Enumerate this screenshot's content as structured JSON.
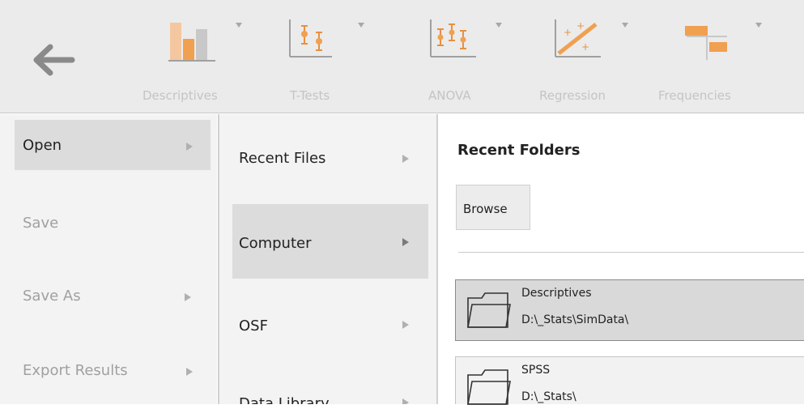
{
  "toolbar": {
    "tools": [
      {
        "label": "Descriptives",
        "icon": "descriptives-bar-icon"
      },
      {
        "label": "T-Tests",
        "icon": "t-tests-icon"
      },
      {
        "label": "ANOVA",
        "icon": "anova-icon"
      },
      {
        "label": "Regression",
        "icon": "regression-icon"
      },
      {
        "label": "Frequencies",
        "icon": "frequencies-icon"
      }
    ]
  },
  "menu": {
    "level1": [
      {
        "label": "Open",
        "selected": true,
        "has_submenu": true,
        "enabled": true
      },
      {
        "label": "Save",
        "selected": false,
        "has_submenu": false,
        "enabled": false
      },
      {
        "label": "Save As",
        "selected": false,
        "has_submenu": true,
        "enabled": false
      },
      {
        "label": "Export Results",
        "selected": false,
        "has_submenu": true,
        "enabled": false
      }
    ],
    "level2": [
      {
        "label": "Recent Files",
        "selected": false,
        "has_submenu": true
      },
      {
        "label": "Computer",
        "selected": true,
        "has_submenu": true
      },
      {
        "label": "OSF",
        "selected": false,
        "has_submenu": true
      },
      {
        "label": "Data Library",
        "selected": false,
        "has_submenu": true
      }
    ]
  },
  "recent": {
    "title": "Recent Folders",
    "browse_label": "Browse",
    "folders": [
      {
        "name": "Descriptives",
        "path": "D:\\_Stats\\SimData\\",
        "selected": true
      },
      {
        "name": "SPSS",
        "path": "D:\\_Stats\\",
        "selected": false
      }
    ]
  },
  "colors": {
    "toolbar_bg": "#ebebeb",
    "menu_bg": "#f3f3f3",
    "selected_bg": "#dcdcdc",
    "icon_orange": "#f0a050",
    "disabled_text": "#a0a0a0"
  }
}
